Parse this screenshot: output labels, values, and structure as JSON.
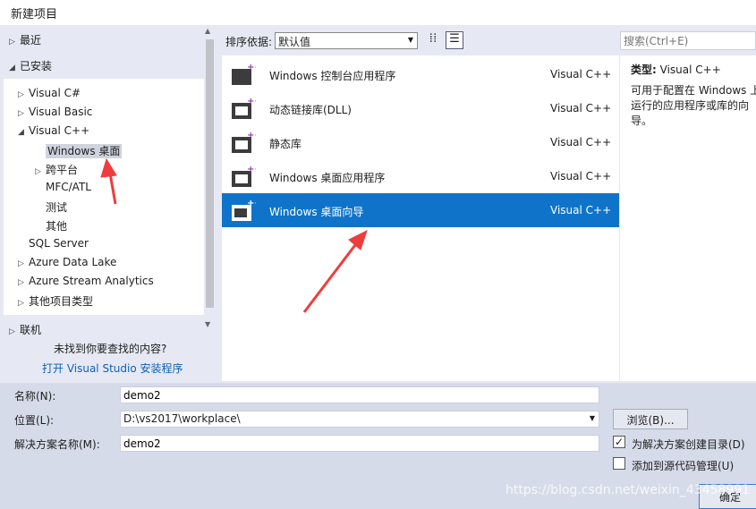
{
  "window": {
    "title": "新建项目"
  },
  "left": {
    "recent": "最近",
    "installed": "已安装",
    "tree": [
      {
        "label": "Visual C#",
        "expander": "collapsed"
      },
      {
        "label": "Visual Basic",
        "expander": "collapsed"
      },
      {
        "label": "Visual C++",
        "expander": "expanded"
      },
      {
        "label": "Windows 桌面",
        "expander": "none",
        "selected": true
      },
      {
        "label": "跨平台",
        "expander": "collapsed"
      },
      {
        "label": "MFC/ATL",
        "expander": "none"
      },
      {
        "label": "测试",
        "expander": "none"
      },
      {
        "label": "其他",
        "expander": "none"
      },
      {
        "label": "SQL Server",
        "expander": "none"
      },
      {
        "label": "Azure Data Lake",
        "expander": "collapsed"
      },
      {
        "label": "Azure Stream Analytics",
        "expander": "collapsed"
      },
      {
        "label": "其他项目类型",
        "expander": "collapsed"
      }
    ],
    "online": "联机",
    "not_found": "未找到你要查找的内容?",
    "open_installer": "打开 Visual Studio 安装程序"
  },
  "toolbar": {
    "sort_label": "排序依据:",
    "sort_value": "默认值",
    "search_placeholder": "搜索(Ctrl+E)"
  },
  "templates": [
    {
      "name": "Windows 控制台应用程序",
      "lang": "Visual C++",
      "icon": "console-app-icon"
    },
    {
      "name": "动态链接库(DLL)",
      "lang": "Visual C++",
      "icon": "dll-icon"
    },
    {
      "name": "静态库",
      "lang": "Visual C++",
      "icon": "static-lib-icon"
    },
    {
      "name": "Windows 桌面应用程序",
      "lang": "Visual C++",
      "icon": "desktop-app-icon"
    },
    {
      "name": "Windows 桌面向导",
      "lang": "Visual C++",
      "icon": "desktop-wizard-icon",
      "selected": true
    }
  ],
  "detail": {
    "type_label": "类型:",
    "type_value": "Visual C++",
    "description": "可用于配置在 Windows 上运行的应用程序或库的向导。"
  },
  "form": {
    "name_label": "名称(N):",
    "name_value": "demo2",
    "location_label": "位置(L):",
    "location_value": "D:\\vs2017\\workplace\\",
    "solution_label": "解决方案名称(M):",
    "solution_value": "demo2",
    "browse": "浏览(B)...",
    "create_dir": "为解决方案创建目录(D)",
    "create_dir_checked": true,
    "source_control": "添加到源代码管理(U)",
    "source_control_checked": false,
    "ok": "确定"
  },
  "watermark": "https://blog.csdn.net/weixin_43458991",
  "colors": {
    "selection": "#0f74c9",
    "annotation_arrow": "#f03c3c"
  }
}
